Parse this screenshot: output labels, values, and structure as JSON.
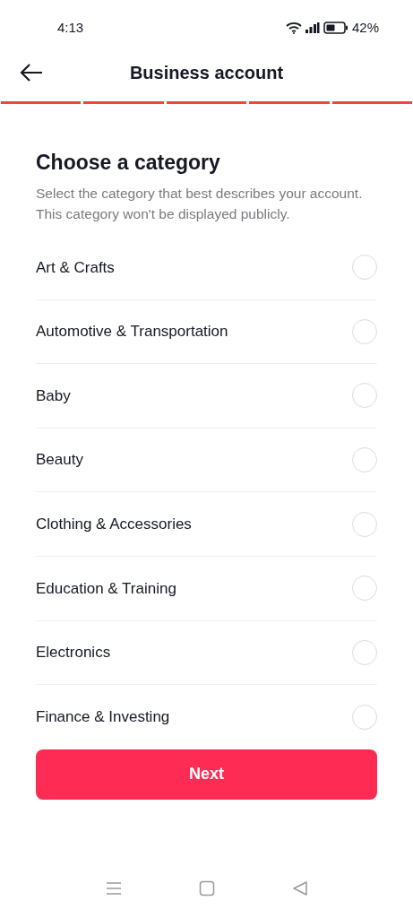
{
  "status_bar": {
    "time": "4:13",
    "battery": "42%"
  },
  "header": {
    "title": "Business account"
  },
  "progress": [
    {
      "done": true
    },
    {
      "done": true
    },
    {
      "done": true
    },
    {
      "done": true
    },
    {
      "done": true
    }
  ],
  "heading": "Choose a category",
  "description": "Select the category that best describes your account. This category won't be displayed publicly.",
  "categories": [
    {
      "label": "Art & Crafts",
      "selected": false
    },
    {
      "label": "Automotive & Transportation",
      "selected": false
    },
    {
      "label": "Baby",
      "selected": false
    },
    {
      "label": "Beauty",
      "selected": false
    },
    {
      "label": "Clothing & Accessories",
      "selected": false
    },
    {
      "label": "Education & Training",
      "selected": false
    },
    {
      "label": "Electronics",
      "selected": false
    },
    {
      "label": "Finance & Investing",
      "selected": false
    }
  ],
  "next_button": "Next"
}
